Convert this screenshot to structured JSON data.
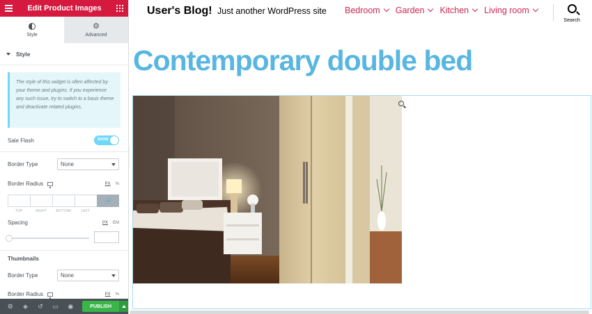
{
  "panel": {
    "title": "Edit Product Images",
    "tabs": [
      {
        "label": "Style",
        "icon": "half-circle-icon",
        "active": true
      },
      {
        "label": "Advanced",
        "icon": "gear-icon",
        "active": false
      }
    ],
    "section": "Style",
    "notice": "The style of this widget is often affected by your theme and plugins. If you experience any such issue, try to switch to a basic theme and deactivate related plugins.",
    "sale_flash": {
      "label": "Sale Flash",
      "toggle_text": "SHOW",
      "on": true
    },
    "border_type": {
      "label": "Border Type",
      "value": "None"
    },
    "border_radius": {
      "label": "Border Radius",
      "unit_px": "PX",
      "unit_pct": "%",
      "dims": [
        "TOP",
        "RIGHT",
        "BOTTOM",
        "LEFT"
      ]
    },
    "spacing": {
      "label": "Spacing",
      "unit_px": "PX",
      "unit_em": "EM"
    },
    "thumbnails": "Thumbnails",
    "thumb_border_type": {
      "label": "Border Type",
      "value": "None"
    },
    "thumb_border_radius": {
      "label": "Border Radius",
      "unit_px": "PX",
      "unit_pct": "%"
    },
    "footer": {
      "publish": "PUBLISH"
    }
  },
  "site": {
    "title": "User's Blog!",
    "tagline": "Just another WordPress site",
    "nav": [
      "Bedroom",
      "Garden",
      "Kitchen",
      "Living room"
    ],
    "search_label": "Search",
    "entry_title": "Contemporary double bed"
  },
  "colors": {
    "accent": "#d5193f",
    "nav": "#cd2653",
    "title": "#58b6e0",
    "publish": "#39b54a"
  }
}
